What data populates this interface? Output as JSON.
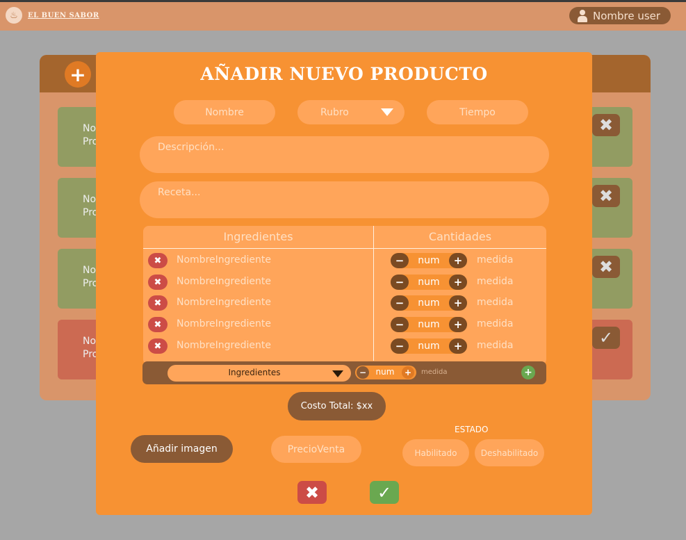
{
  "topbar": {
    "brand_icon": "chef-hat-icon",
    "brand_name": "EL BUEN SABOR",
    "user_name": "Nombre user",
    "colors": {
      "bar": "#d9956a",
      "chip": "#8a5a35"
    }
  },
  "background": {
    "add_glyph": "+",
    "cards": [
      {
        "text_line1": "No",
        "text_line2": "Pro",
        "button_glyph": "✖",
        "status": "green"
      },
      {
        "text_line1": "No",
        "text_line2": "Pro",
        "button_glyph": "✖",
        "status": "green"
      },
      {
        "text_line1": "No",
        "text_line2": "Pro",
        "button_glyph": "✖",
        "status": "green"
      },
      {
        "text_line1": "No",
        "text_line2": "Pro",
        "button_glyph": "✓",
        "status": "red"
      }
    ]
  },
  "modal": {
    "title": "AÑADIR NUEVO PRODUCTO",
    "fields": {
      "nombre_placeholder": "Nombre",
      "rubro_placeholder": "Rubro",
      "tiempo_placeholder": "Tiempo",
      "descripcion_placeholder": "Descripción...",
      "receta_placeholder": "Receta..."
    },
    "ingredients_table": {
      "header_ingredients": "Ingredientes",
      "header_quantities": "Cantidades",
      "rows": [
        {
          "delete_glyph": "✖",
          "name": "NombreIngrediente",
          "minus": "−",
          "qty": "num",
          "plus": "+",
          "unit": "medida"
        },
        {
          "delete_glyph": "✖",
          "name": "NombreIngrediente",
          "minus": "−",
          "qty": "num",
          "plus": "+",
          "unit": "medida"
        },
        {
          "delete_glyph": "✖",
          "name": "NombreIngrediente",
          "minus": "−",
          "qty": "num",
          "plus": "+",
          "unit": "medida"
        },
        {
          "delete_glyph": "✖",
          "name": "NombreIngrediente",
          "minus": "−",
          "qty": "num",
          "plus": "+",
          "unit": "medida"
        },
        {
          "delete_glyph": "✖",
          "name": "NombreIngrediente",
          "minus": "−",
          "qty": "num",
          "plus": "+",
          "unit": "medida"
        }
      ],
      "add_row": {
        "select_value": "Ingredientes",
        "minus": "−",
        "qty": "num",
        "plus": "+",
        "unit": "medida",
        "add_glyph": "+"
      }
    },
    "cost_total": "Costo Total: $xx",
    "add_image": "Añadir imagen",
    "precio_venta_placeholder": "PrecioVenta",
    "estado": {
      "label": "ESTADO",
      "enabled": "Habilitado",
      "disabled": "Deshabilitado"
    },
    "cancel_glyph": "✖",
    "confirm_glyph": "✓",
    "colors": {
      "modal_bg": "#f79233",
      "field_bg": "#ffa55a",
      "dark_brown": "#8a5a35",
      "cancel": "#cc4c46",
      "confirm": "#6aa850"
    }
  }
}
